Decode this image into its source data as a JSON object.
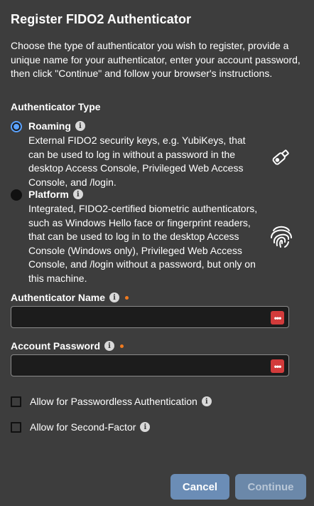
{
  "dialog": {
    "title": "Register FIDO2 Authenticator",
    "intro": "Choose the type of authenticator you wish to register, provide a unique name for your authenticator, enter your account password, then click \"Continue\" and follow your browser's instructions."
  },
  "authenticator_type": {
    "label": "Authenticator Type",
    "options": [
      {
        "title": "Roaming",
        "selected": true,
        "description": "External FIDO2 security keys, e.g. YubiKeys, that can be used to log in without a password in the desktop Access Console, Privileged Web Access Console, and /login.",
        "icon": "usb-key-icon"
      },
      {
        "title": "Platform",
        "selected": false,
        "description": "Integrated, FIDO2-certified biometric authenticators, such as Windows Hello face or fingerprint readers, that can be used to log in to the desktop Access Console (Windows only), Privileged Web Access Console, and /login without a password, but only on this machine.",
        "icon": "fingerprint-icon"
      }
    ]
  },
  "fields": {
    "name_label": "Authenticator Name",
    "name_value": "",
    "password_label": "Account Password",
    "password_value": ""
  },
  "checkboxes": {
    "passwordless_label": "Allow for Passwordless Authentication",
    "passwordless_checked": false,
    "second_factor_label": "Allow for Second-Factor",
    "second_factor_checked": false
  },
  "buttons": {
    "cancel": "Cancel",
    "continue": "Continue"
  },
  "colors": {
    "background": "#3d3d3d",
    "accent": "#5aa2ff",
    "required": "#f07a1f",
    "password_manager": "#d23b3b"
  }
}
